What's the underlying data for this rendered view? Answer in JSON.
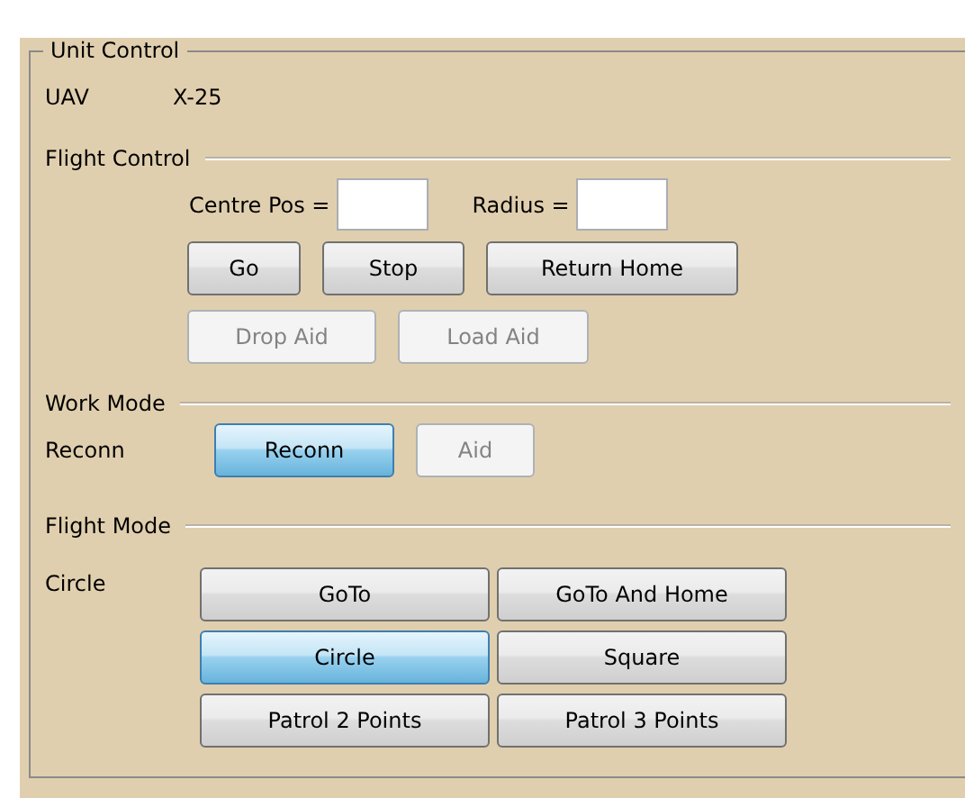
{
  "group": {
    "title": "Unit Control"
  },
  "unit": {
    "label": "UAV",
    "value": "X-25"
  },
  "flight_control": {
    "title": "Flight Control",
    "fields": [
      {
        "label": "Centre Pos ="
      },
      {
        "label": "Radius ="
      }
    ],
    "button_rows": [
      [
        {
          "label": "Go",
          "disabled": false
        },
        {
          "label": "Stop",
          "disabled": false
        },
        {
          "label": "Return Home",
          "disabled": false
        }
      ],
      [
        {
          "label": "Drop Aid",
          "disabled": true
        },
        {
          "label": "Load Aid",
          "disabled": true
        }
      ]
    ]
  },
  "work_mode": {
    "title": "Work Mode",
    "current": "Reconn",
    "options": [
      {
        "label": "Reconn",
        "selected": true,
        "disabled": false
      },
      {
        "label": "Aid",
        "selected": false,
        "disabled": true
      }
    ]
  },
  "flight_mode": {
    "title": "Flight Mode",
    "current": "Circle",
    "options": [
      {
        "label": "GoTo",
        "selected": false
      },
      {
        "label": "GoTo And Home",
        "selected": false
      },
      {
        "label": "Circle",
        "selected": true
      },
      {
        "label": "Square",
        "selected": false
      },
      {
        "label": "Patrol 2 Points",
        "selected": false
      },
      {
        "label": "Patrol 3 Points",
        "selected": false
      }
    ]
  }
}
